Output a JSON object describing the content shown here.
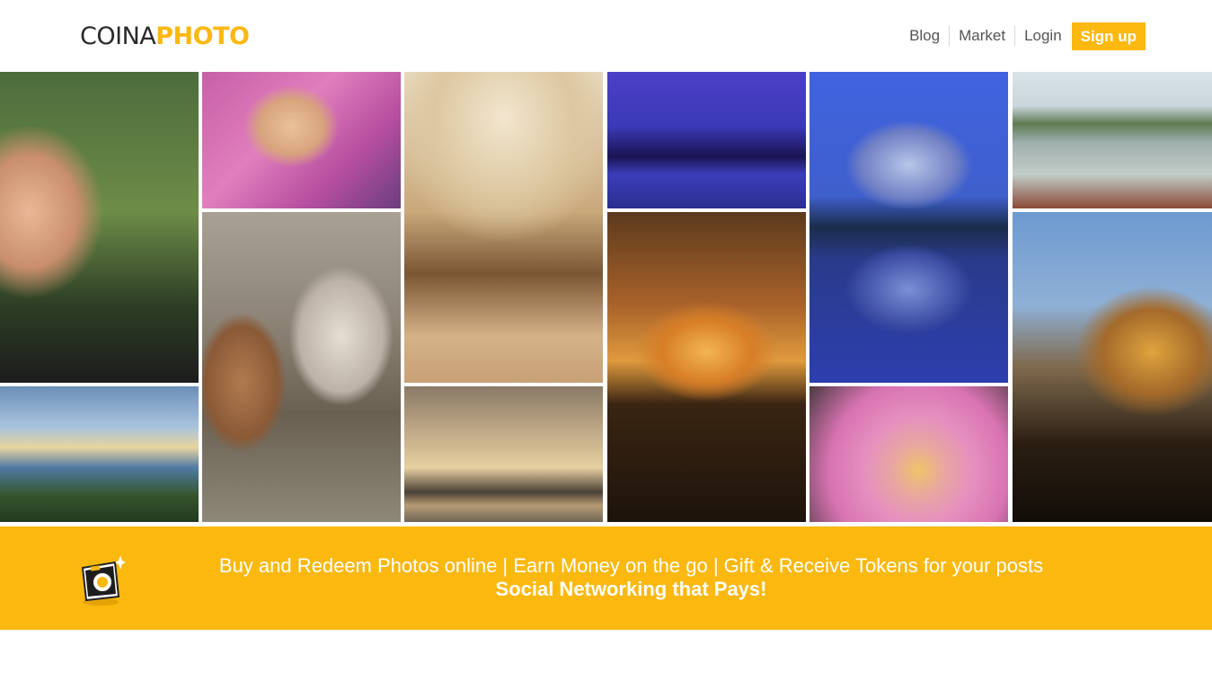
{
  "header": {
    "logo": {
      "part1": "COINA",
      "part2": "PHOTO"
    },
    "nav": [
      {
        "label": "Blog"
      },
      {
        "label": "Market"
      },
      {
        "label": "Login"
      }
    ],
    "signup_label": "Sign up"
  },
  "banner": {
    "icon": "camera-icon",
    "line1": "Buy and Redeem Photos online | Earn Money on the go | Gift & Receive Tokens for your posts",
    "line2": "Social Networking that Pays!"
  },
  "colors": {
    "brand_yellow": "#fbb80f",
    "logo_dark": "#2a2a2a",
    "nav_text": "#555555"
  }
}
